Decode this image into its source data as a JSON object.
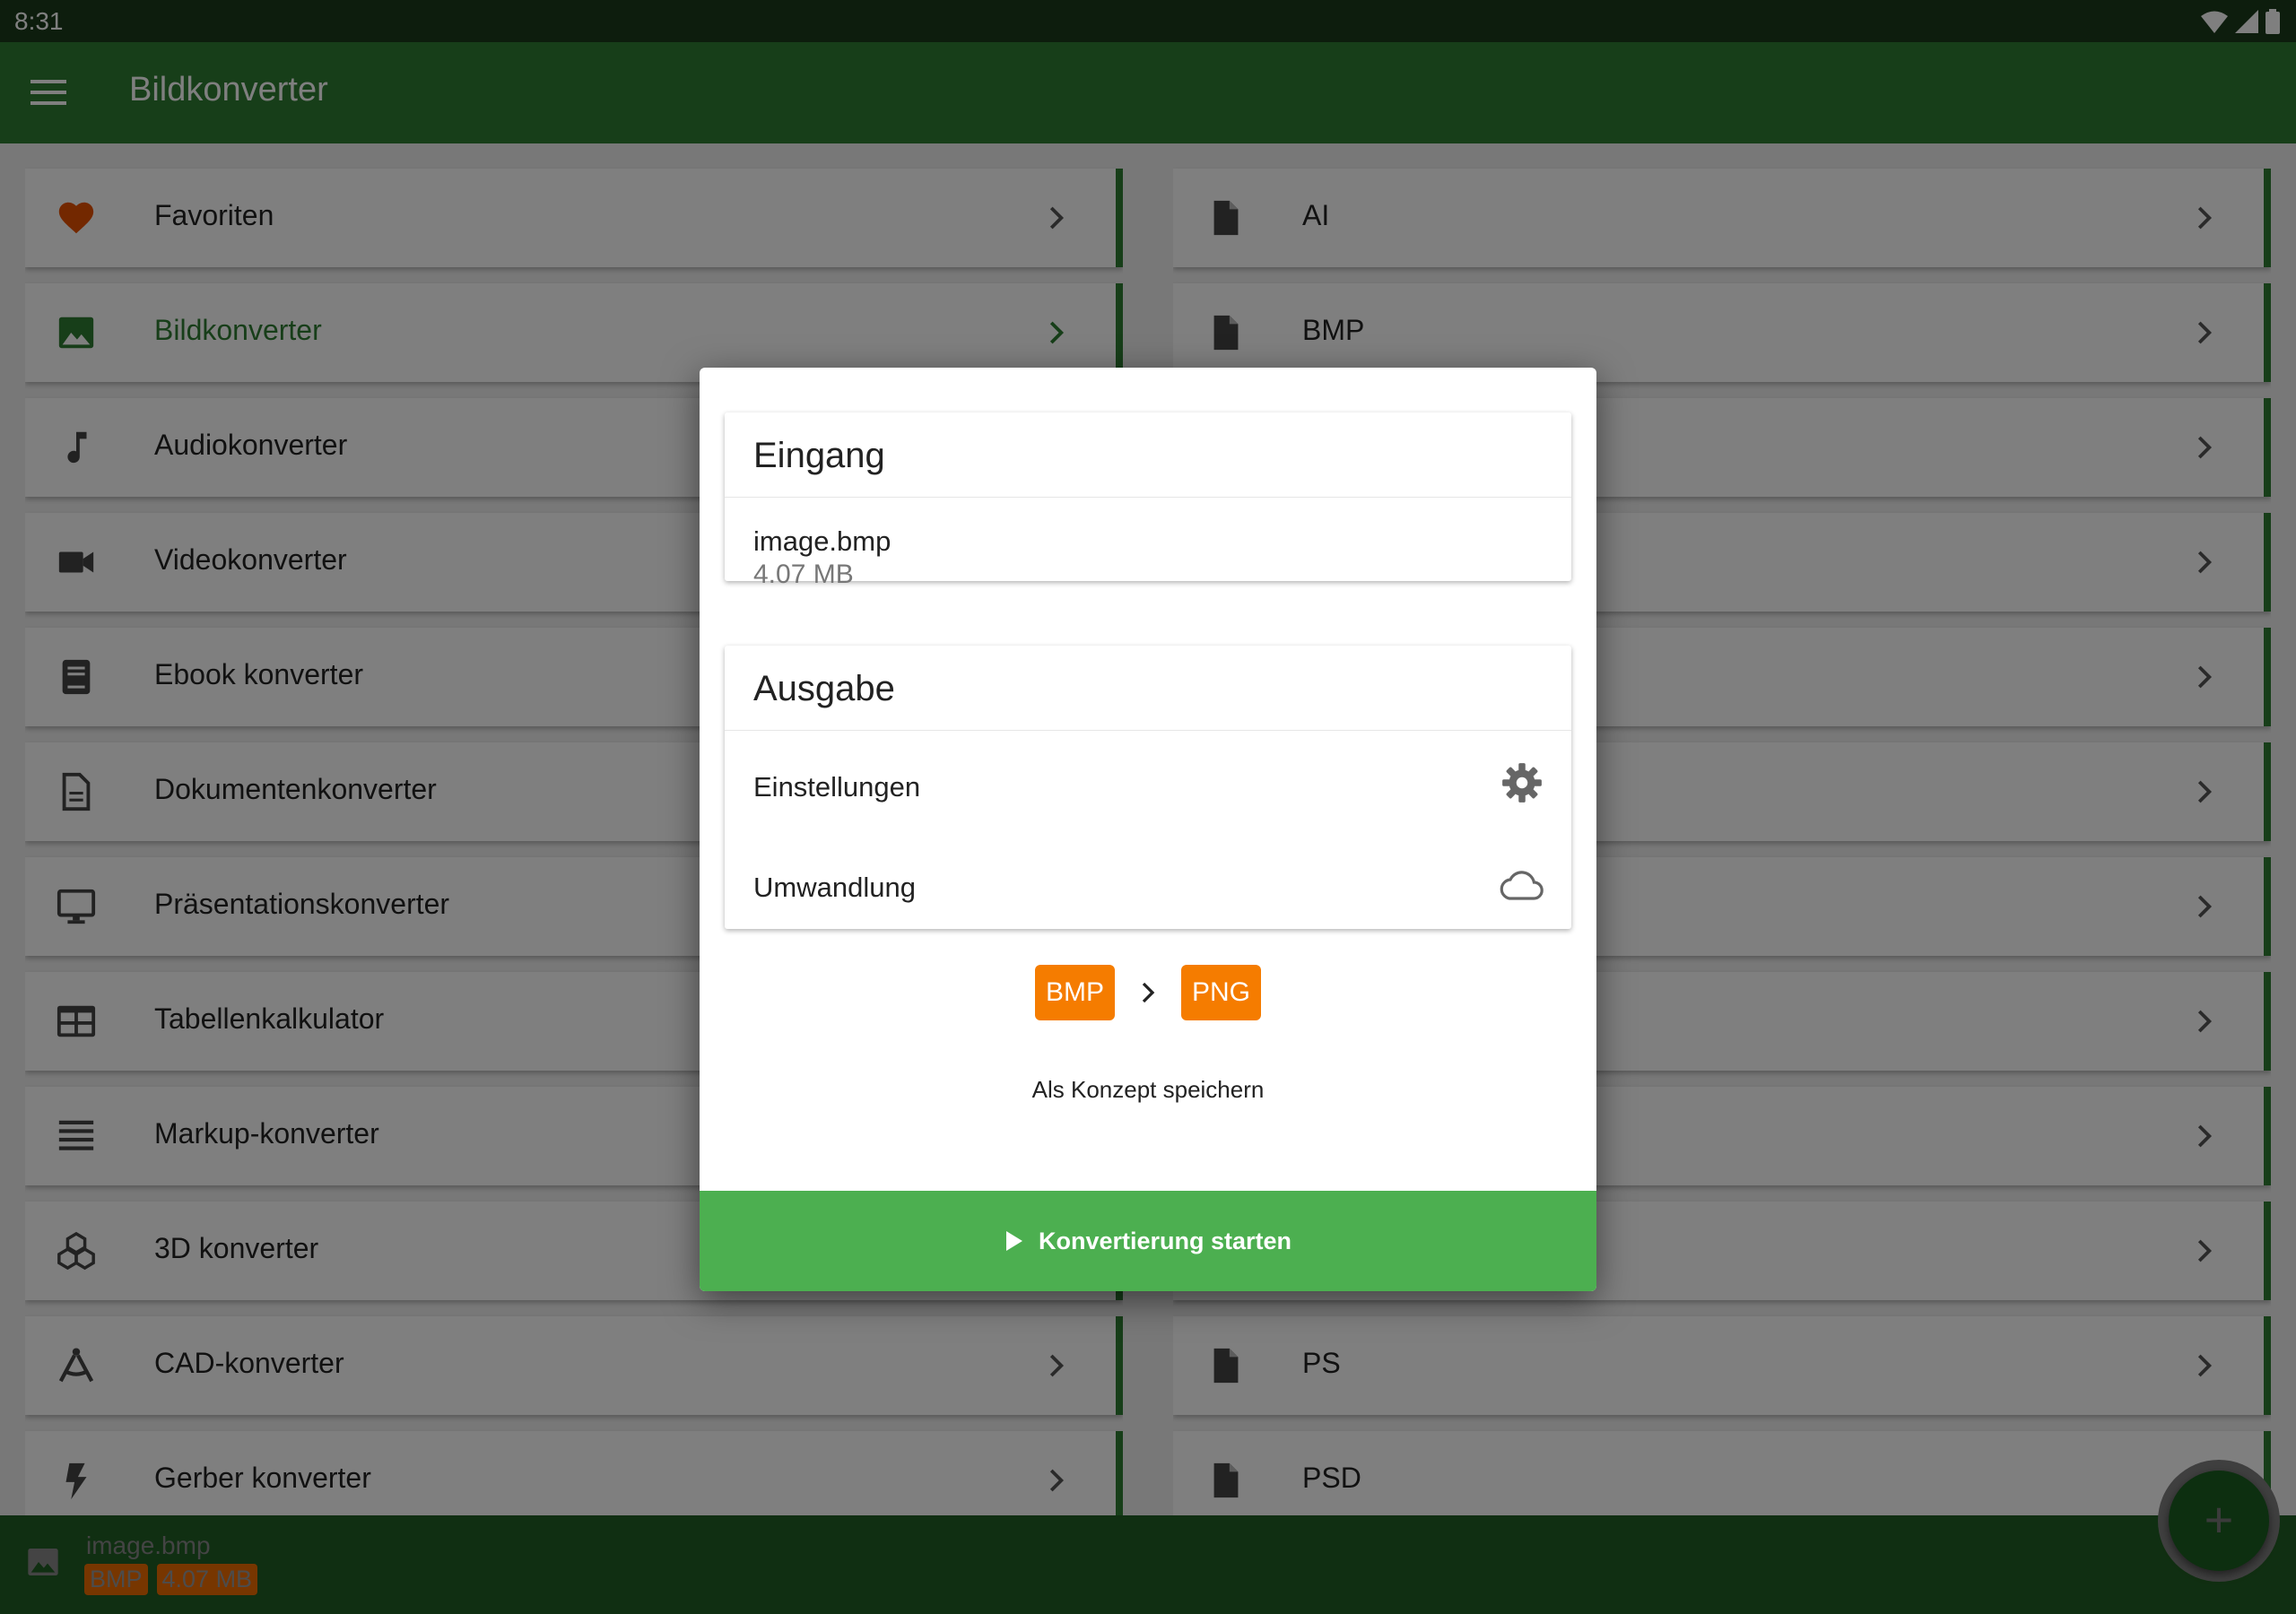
{
  "status": {
    "time": "8:31"
  },
  "appbar": {
    "title": "Bildkonverter"
  },
  "left_list": [
    {
      "label": "Favoriten",
      "icon": "heart-icon"
    },
    {
      "label": "Bildkonverter",
      "icon": "image-icon"
    },
    {
      "label": "Audiokonverter",
      "icon": "music-note-icon"
    },
    {
      "label": "Videokonverter",
      "icon": "video-camera-icon"
    },
    {
      "label": "Ebook konverter",
      "icon": "book-icon"
    },
    {
      "label": "Dokumentenkonverter",
      "icon": "document-icon"
    },
    {
      "label": "Präsentationskonverter",
      "icon": "monitor-icon"
    },
    {
      "label": "Tabellenkalkulator",
      "icon": "table-icon"
    },
    {
      "label": "Markup-konverter",
      "icon": "lines-icon"
    },
    {
      "label": "3D konverter",
      "icon": "cubes-icon"
    },
    {
      "label": "CAD-konverter",
      "icon": "compass-icon"
    },
    {
      "label": "Gerber konverter",
      "icon": "bolt-icon"
    }
  ],
  "right_list": [
    {
      "label": "AI"
    },
    {
      "label": "BMP"
    },
    {
      "label": ""
    },
    {
      "label": ""
    },
    {
      "label": ""
    },
    {
      "label": ""
    },
    {
      "label": ""
    },
    {
      "label": ""
    },
    {
      "label": ""
    },
    {
      "label": ""
    },
    {
      "label": "PS"
    },
    {
      "label": "PSD"
    }
  ],
  "dialog": {
    "input": {
      "title": "Eingang",
      "file_name": "image.bmp",
      "file_size": "4.07 MB"
    },
    "output": {
      "title": "Ausgabe",
      "settings_label": "Einstellungen",
      "conversion_label": "Umwandlung"
    },
    "from_format": "BMP",
    "to_format": "PNG",
    "save_draft_label": "Als Konzept speichern",
    "start_label": "Konvertierung starten"
  },
  "bottom_bar": {
    "file_name": "image.bmp",
    "format": "BMP",
    "size": "4.07 MB"
  },
  "fab": {
    "label": "+"
  },
  "colors": {
    "primary": "#2e7d32",
    "primary_dark": "#1b5e20",
    "accent": "#f57c00",
    "button": "#4caf50",
    "heart": "#e65100"
  }
}
